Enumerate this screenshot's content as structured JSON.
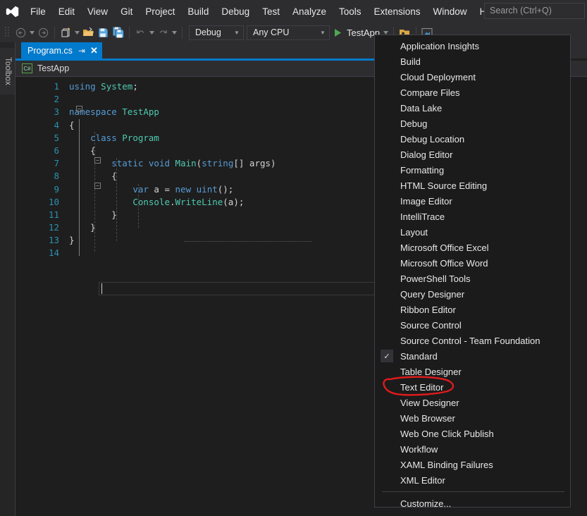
{
  "app": {
    "logo_icon": "visual-studio-logo",
    "search": {
      "placeholder": "Search (Ctrl+Q)",
      "value": ""
    },
    "accent_color": "#007acc",
    "menu_bg": "#1b1b1c",
    "annotation_color": "#e01b1b"
  },
  "menubar": {
    "items": [
      {
        "label": "File"
      },
      {
        "label": "Edit"
      },
      {
        "label": "View"
      },
      {
        "label": "Git"
      },
      {
        "label": "Project"
      },
      {
        "label": "Build"
      },
      {
        "label": "Debug"
      },
      {
        "label": "Test"
      },
      {
        "label": "Analyze"
      },
      {
        "label": "Tools"
      },
      {
        "label": "Extensions"
      },
      {
        "label": "Window"
      },
      {
        "label": "Help"
      }
    ]
  },
  "toolbar": {
    "nav_back_icon": "navigate-back-icon",
    "nav_forward_icon": "navigate-forward-icon",
    "new_project_icon": "new-project-icon",
    "open_file_icon": "open-file-icon",
    "save_icon": "save-icon",
    "save_all_icon": "save-all-icon",
    "undo_icon": "undo-icon",
    "redo_icon": "redo-icon",
    "configuration": {
      "value": "Debug",
      "dropdown_icon": "chevron-down-icon"
    },
    "platform": {
      "value": "Any CPU",
      "dropdown_icon": "chevron-down-icon"
    },
    "run": {
      "label": "TestApp",
      "play_icon": "play-icon",
      "dropdown_icon": "chevron-down-icon"
    },
    "extra_icons": [
      {
        "name": "select-window-icon"
      },
      {
        "name": "live-share-icon"
      }
    ]
  },
  "toolbox": {
    "label": "Toolbox"
  },
  "editor": {
    "tab": {
      "filename": "Program.cs",
      "pin_icon": "pin-icon",
      "close_icon": "close-icon"
    },
    "navbar": {
      "language_badge": "C#",
      "scope": "TestApp"
    },
    "lines": [
      {
        "num": "1",
        "text": "using System;"
      },
      {
        "num": "2",
        "text": ""
      },
      {
        "num": "3",
        "text": "namespace TestApp"
      },
      {
        "num": "4",
        "text": "{"
      },
      {
        "num": "5",
        "text": "    class Program"
      },
      {
        "num": "6",
        "text": "    {"
      },
      {
        "num": "7",
        "text": "        static void Main(string[] args)"
      },
      {
        "num": "8",
        "text": "        {"
      },
      {
        "num": "9",
        "text": "            var a = new uint();"
      },
      {
        "num": "10",
        "text": "            Console.WriteLine(a);"
      },
      {
        "num": "11",
        "text": "        }"
      },
      {
        "num": "12",
        "text": "    }"
      },
      {
        "num": "13",
        "text": "}"
      },
      {
        "num": "14",
        "text": ""
      }
    ]
  },
  "context_menu": {
    "items": [
      {
        "label": "Application Insights",
        "checked": false
      },
      {
        "label": "Build",
        "checked": false
      },
      {
        "label": "Cloud Deployment",
        "checked": false
      },
      {
        "label": "Compare Files",
        "checked": false
      },
      {
        "label": "Data Lake",
        "checked": false
      },
      {
        "label": "Debug",
        "checked": false
      },
      {
        "label": "Debug Location",
        "checked": false
      },
      {
        "label": "Dialog Editor",
        "checked": false
      },
      {
        "label": "Formatting",
        "checked": false
      },
      {
        "label": "HTML Source Editing",
        "checked": false
      },
      {
        "label": "Image Editor",
        "checked": false
      },
      {
        "label": "IntelliTrace",
        "checked": false
      },
      {
        "label": "Layout",
        "checked": false
      },
      {
        "label": "Microsoft Office Excel",
        "checked": false
      },
      {
        "label": "Microsoft Office Word",
        "checked": false
      },
      {
        "label": "PowerShell Tools",
        "checked": false
      },
      {
        "label": "Query Designer",
        "checked": false
      },
      {
        "label": "Ribbon Editor",
        "checked": false
      },
      {
        "label": "Source Control",
        "checked": false
      },
      {
        "label": "Source Control - Team Foundation",
        "checked": false
      },
      {
        "label": "Standard",
        "checked": true
      },
      {
        "label": "Table Designer",
        "checked": false
      },
      {
        "label": "Text Editor",
        "checked": false
      },
      {
        "label": "View Designer",
        "checked": false
      },
      {
        "label": "Web Browser",
        "checked": false
      },
      {
        "label": "Web One Click Publish",
        "checked": false
      },
      {
        "label": "Workflow",
        "checked": false
      },
      {
        "label": "XAML Binding Failures",
        "checked": false
      },
      {
        "label": "XML Editor",
        "checked": false
      }
    ],
    "footer": {
      "label": "Customize..."
    },
    "check_glyph": "✓"
  },
  "annotation": {
    "target_label": "Text Editor",
    "shape": "hand-drawn-ellipse"
  }
}
